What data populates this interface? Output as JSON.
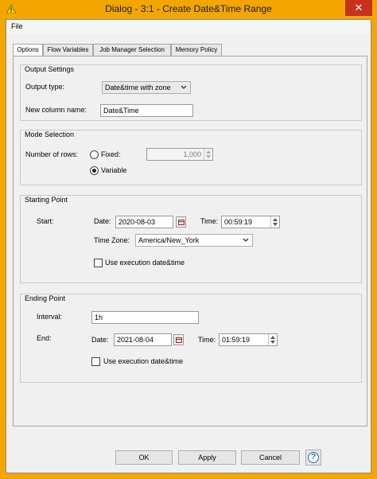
{
  "window": {
    "title": "Dialog - 3:1 - Create Date&Time Range",
    "close_glyph": "✕"
  },
  "menubar": {
    "items": [
      {
        "label": "File"
      }
    ]
  },
  "tabs": [
    {
      "label": "Options",
      "active": true
    },
    {
      "label": "Flow Variables",
      "active": false
    },
    {
      "label": "Job Manager Selection",
      "active": false
    },
    {
      "label": "Memory Policy",
      "active": false
    }
  ],
  "output_settings": {
    "title": "Output Settings",
    "output_type_label": "Output type:",
    "output_type_value": "Date&time with zone",
    "column_name_label": "New column name:",
    "column_name_value": "Date&Time"
  },
  "mode_selection": {
    "title": "Mode Selection",
    "rows_label": "Number of rows:",
    "fixed_label": "Fixed:",
    "fixed_value": "1,000",
    "variable_label": "Variable",
    "selected": "variable"
  },
  "starting_point": {
    "title": "Starting Point",
    "start_label": "Start:",
    "date_label": "Date:",
    "date_value": "2020-08-03",
    "time_label": "Time:",
    "time_value": "00:59:19",
    "timezone_label": "Time Zone:",
    "timezone_value": "America/New_York",
    "use_exec_label": "Use execution date&time",
    "use_exec_checked": false
  },
  "ending_point": {
    "title": "Ending Point",
    "interval_label": "Interval:",
    "interval_value": "1h",
    "end_label": "End:",
    "date_label": "Date:",
    "date_value": "2021-08-04",
    "time_label": "Time:",
    "time_value": "01:59:19",
    "use_exec_label": "Use execution date&time",
    "use_exec_checked": false
  },
  "buttons": {
    "ok": "OK",
    "apply": "Apply",
    "cancel": "Cancel",
    "help_glyph": "?"
  },
  "colors": {
    "titlebar": "#f3a600",
    "close": "#c7311e",
    "window_bg": "#f0f0f0",
    "help_accent": "#1e6fb8"
  }
}
